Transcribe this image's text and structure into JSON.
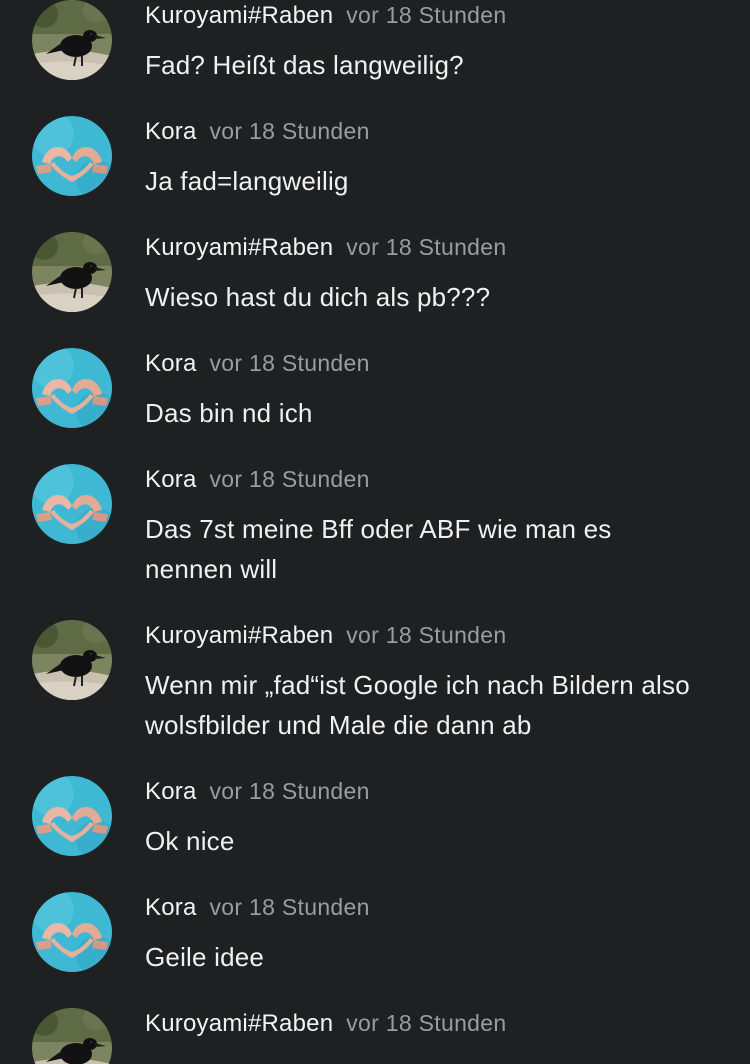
{
  "messages": [
    {
      "author": "Kuroyami#Raben",
      "time": "vor 18 Stunden",
      "text": "Fad? Heißt das langweilig?",
      "avatar": "raven-avatar"
    },
    {
      "author": "Kora",
      "time": "vor 18 Stunden",
      "text": "Ja fad=langweilig",
      "avatar": "heart-hands-avatar"
    },
    {
      "author": "Kuroyami#Raben",
      "time": "vor 18 Stunden",
      "text": "Wieso hast du dich als pb???",
      "avatar": "raven-avatar"
    },
    {
      "author": "Kora",
      "time": "vor 18 Stunden",
      "text": "Das bin nd ich",
      "avatar": "heart-hands-avatar"
    },
    {
      "author": "Kora",
      "time": "vor 18 Stunden",
      "text": "Das 7st meine Bff oder ABF wie man es nennen will",
      "avatar": "heart-hands-avatar"
    },
    {
      "author": "Kuroyami#Raben",
      "time": "vor 18 Stunden",
      "text": "Wenn mir „fad“ist Google ich nach Bildern also wolsfbilder und Male die dann ab",
      "avatar": "raven-avatar"
    },
    {
      "author": "Kora",
      "time": "vor 18 Stunden",
      "text": "Ok nice",
      "avatar": "heart-hands-avatar"
    },
    {
      "author": "Kora",
      "time": "vor 18 Stunden",
      "text": "Geile idee",
      "avatar": "heart-hands-avatar"
    },
    {
      "author": "Kuroyami#Raben",
      "time": "vor 18 Stunden",
      "text": "",
      "avatar": "raven-avatar"
    }
  ],
  "colors": {
    "background": "#1f2021",
    "author": "#f2f2f2",
    "timestamp": "#9c9c9c",
    "text": "#f0f0f0"
  }
}
